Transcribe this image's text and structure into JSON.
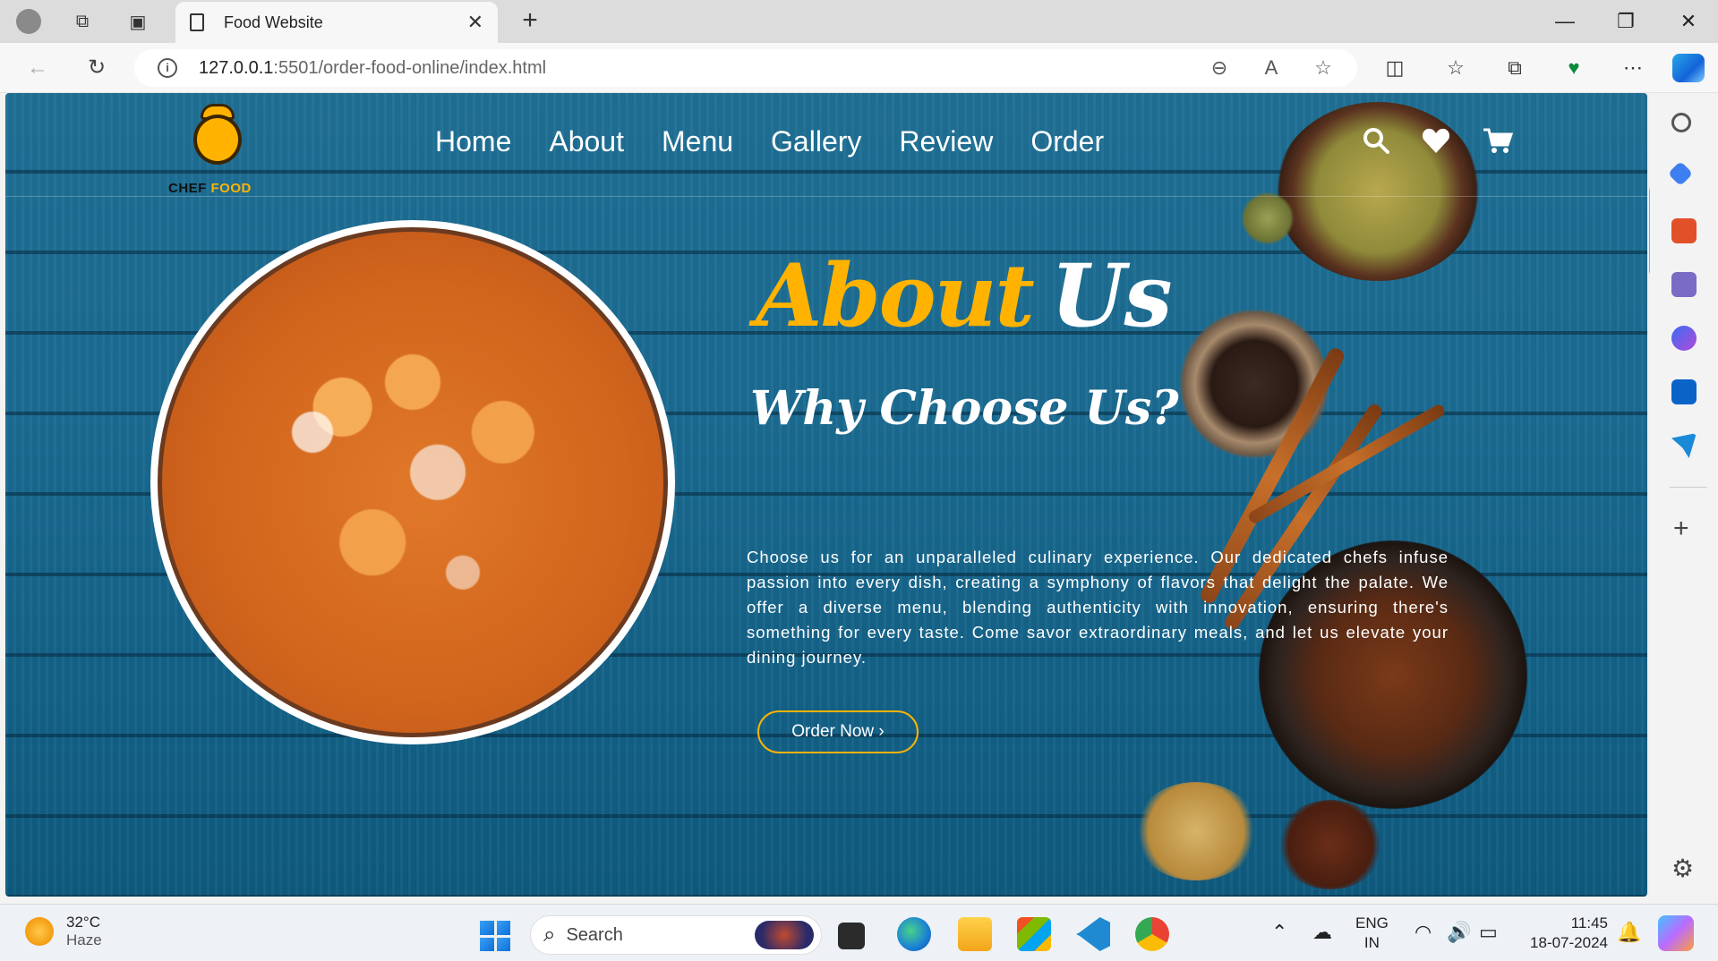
{
  "browser": {
    "tab_title": "Food Website",
    "tab_close": "✕",
    "new_tab": "+",
    "url_host": "127.0.0.1",
    "url_rest": ":5501/order-food-online/index.html",
    "win_min": "—",
    "win_restore": "❐",
    "win_close": "✕"
  },
  "site": {
    "logo_text_1": "CHEF",
    "logo_text_2": "FOOD",
    "nav": [
      "Home",
      "About",
      "Menu",
      "Gallery",
      "Review",
      "Order"
    ],
    "about_word_1": "About",
    "about_word_2": "Us",
    "subtitle": "Why Choose Us?",
    "description": "Choose us for an unparalleled culinary experience. Our dedicated chefs infuse passion into every dish, creating a symphony of flavors that delight the palate. We offer a diverse menu, blending authenticity with innovation, ensuring there's something for every taste. Come savor extraordinary meals, and let us elevate your dining journey.",
    "button": "Order Now ›",
    "icons": [
      "search-icon",
      "heart-icon",
      "cart-icon"
    ],
    "colors": {
      "accent": "#ffb300",
      "background": "#1b6b92"
    }
  },
  "taskbar": {
    "temp": "32°C",
    "weather": "Haze",
    "search_label": "Search",
    "lang_1": "ENG",
    "lang_2": "IN",
    "time": "11:45",
    "date": "18-07-2024"
  }
}
